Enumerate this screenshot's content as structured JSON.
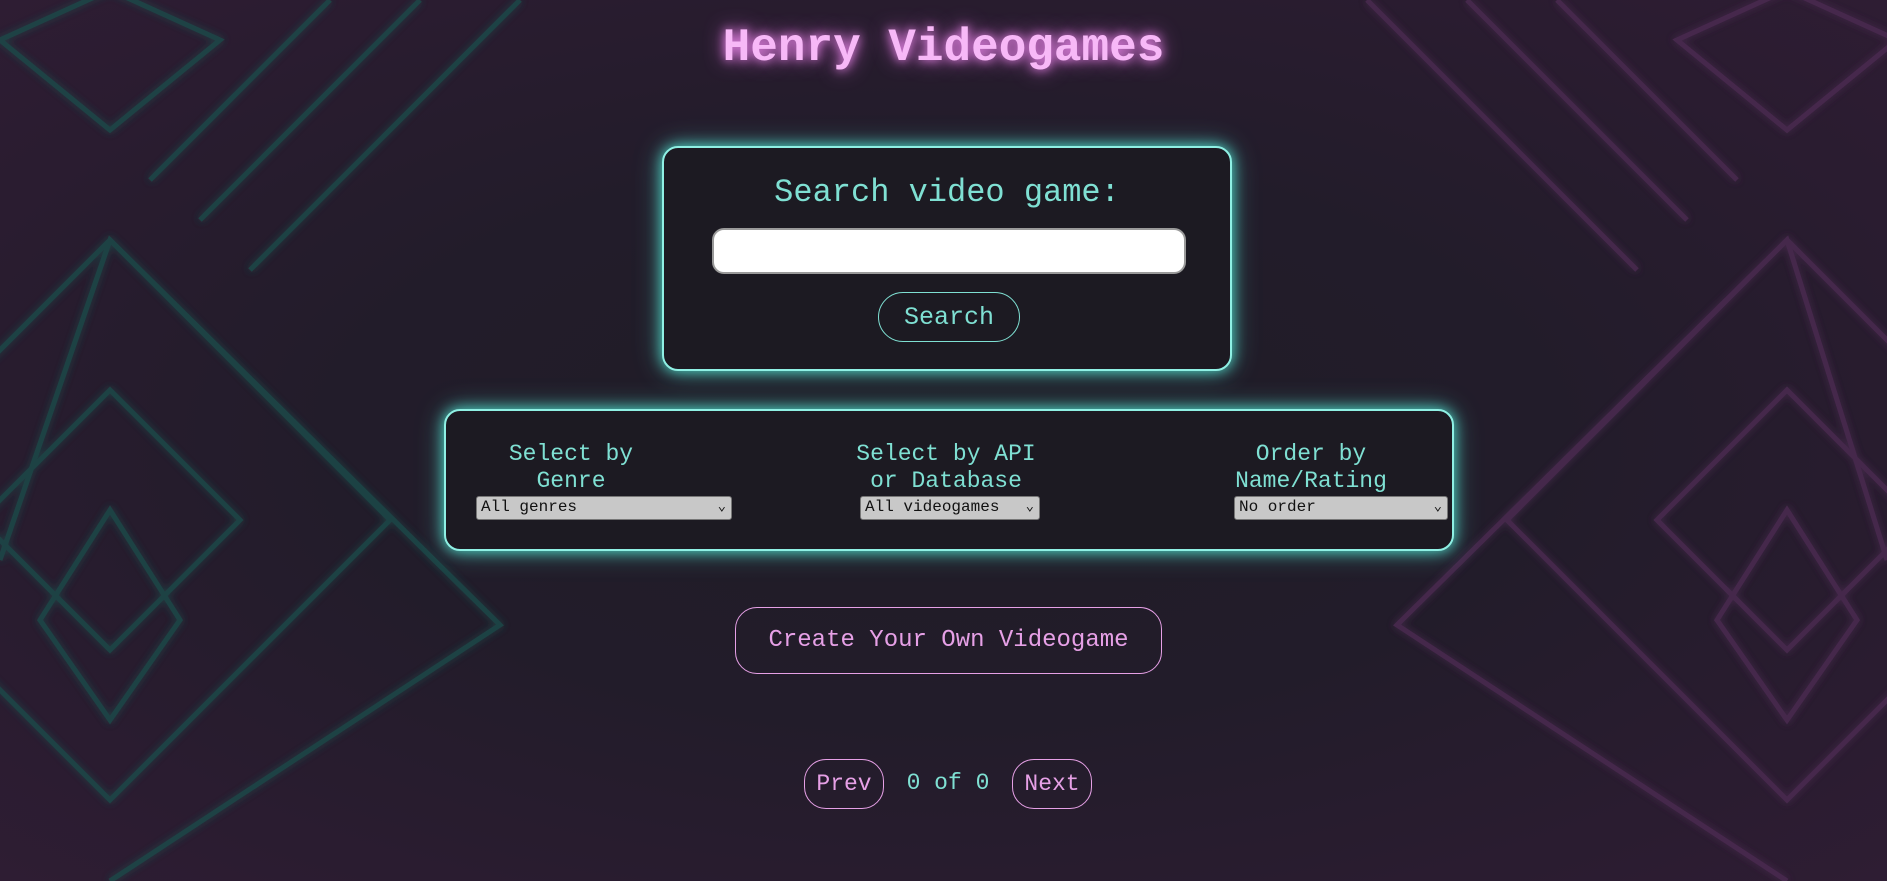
{
  "header": {
    "title": "Henry Videogames"
  },
  "search": {
    "label": "Search video game:",
    "value": "",
    "placeholder": "",
    "button_label": "Search"
  },
  "filters": {
    "genre": {
      "label": "Select by\nGenre",
      "selected": "All genres"
    },
    "source": {
      "label": "Select by API\nor Database",
      "selected": "All videogames"
    },
    "order": {
      "label": "Order by\nName/Rating",
      "selected": "No order"
    }
  },
  "create": {
    "button_label": "Create Your Own Videogame"
  },
  "pagination": {
    "prev_label": "Prev",
    "next_label": "Next",
    "indicator": "0 of 0"
  },
  "colors": {
    "accent_cyan": "#7fe0d3",
    "accent_pink": "#e6a0e6",
    "title_pink": "#f7b8f7",
    "panel_bg": "#1c1a22"
  },
  "icons": {
    "select_chevron": "chevron-down-icon"
  }
}
